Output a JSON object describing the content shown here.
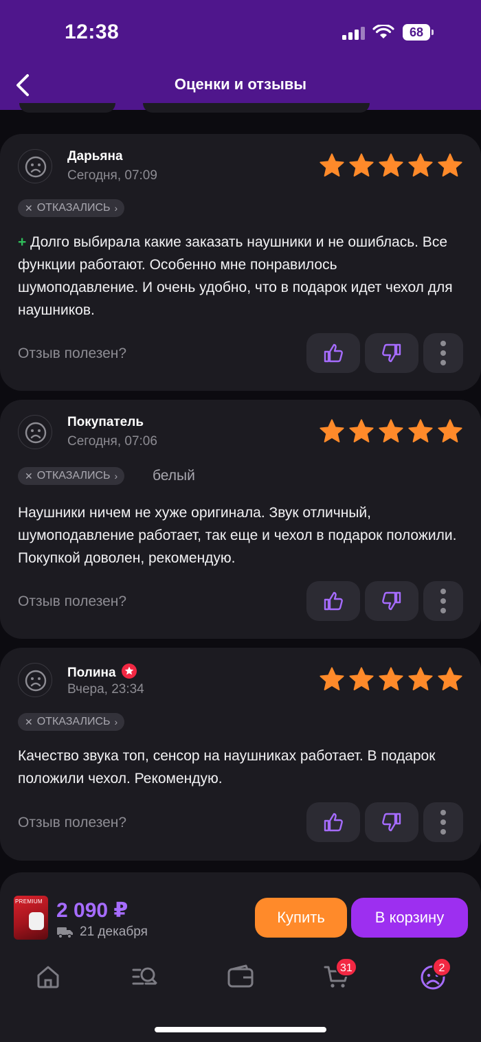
{
  "status_bar": {
    "time": "12:38",
    "battery": "68"
  },
  "header": {
    "title": "Оценки и отзывы"
  },
  "reviews": [
    {
      "author": "Дарьяна",
      "date": "Сегодня, 07:09",
      "rating": 5,
      "status_chip": "ОТКАЗАЛИСЬ",
      "variant": "",
      "plus_marker": "+",
      "text": "Долго выбирала какие заказать наушники и не ошиблась. Все функции работают. Особенно мне понравилось шумоподавление. И очень удобно, что в подарок идет чехол для наушников.",
      "helpful_label": "Отзыв полезен?"
    },
    {
      "author": "Покупатель",
      "date": "Сегодня, 07:06",
      "rating": 5,
      "status_chip": "ОТКАЗАЛИСЬ",
      "variant": "белый",
      "text": "Наушники ничем не хуже оригинала. Звук отличный, шумоподавление работает, так еще и чехол в подарок положили. Покупкой доволен, рекомендую.",
      "helpful_label": "Отзыв полезен?"
    },
    {
      "author": "Полина",
      "date": "Вчера, 23:34",
      "rating": 5,
      "status_chip": "ОТКАЗАЛИСЬ",
      "variant": "",
      "text": "Качество звука топ, сенсор на наушниках работает. В подарок положили чехол. Рекомендую.",
      "helpful_label": "Отзыв полезен?"
    }
  ],
  "product_bar": {
    "thumb_label": "PREMIUM",
    "price": "2 090 ₽",
    "delivery_date": "21 декабря",
    "buy_label": "Купить",
    "cart_label": "В корзину"
  },
  "bottom_nav": {
    "items": [
      "home-icon",
      "catalog-search-icon",
      "wallet-icon",
      "cart-icon",
      "profile-icon"
    ],
    "cart_badge": "31",
    "profile_badge": "2"
  },
  "colors": {
    "header": "#4f168c",
    "star": "#ff8a2a",
    "accent_purple": "#a66cff",
    "buy": "#ff8a2a",
    "cart": "#9d2ff0",
    "badge": "#f22843"
  }
}
